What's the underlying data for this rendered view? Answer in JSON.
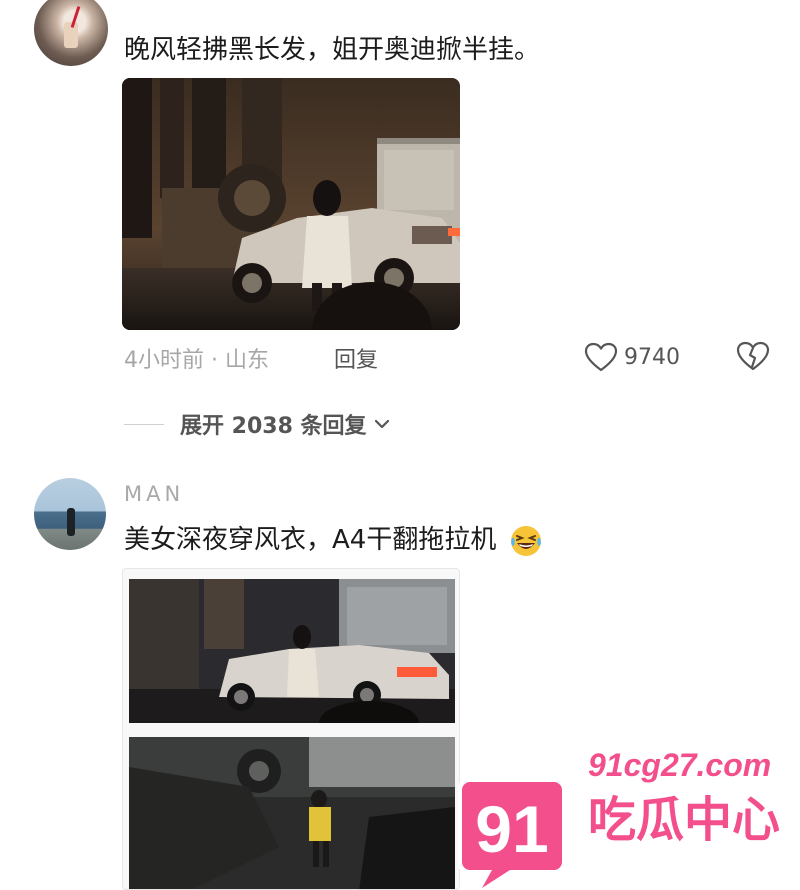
{
  "comments": [
    {
      "avatar": "user-avatar-drink",
      "text": "晚风轻拂黑长发，姐开奥迪掀半挂。",
      "time_location": "4小时前 · 山东",
      "reply_label": "回复",
      "likes": "9740",
      "expand_label": "展开 2038 条回复"
    },
    {
      "avatar": "user-avatar-seaside",
      "username": "MAN",
      "text": "美女深夜穿风衣，A4干翻拖拉机",
      "emoji": "laughing-tears-emoji"
    }
  ],
  "watermark": {
    "domain": "91cg27.com",
    "badge": "91",
    "name": "吃瓜中心"
  },
  "colors": {
    "watermark_pink": "#f24f8c",
    "muted_text": "#a7a7a7",
    "action_text": "#555555"
  }
}
